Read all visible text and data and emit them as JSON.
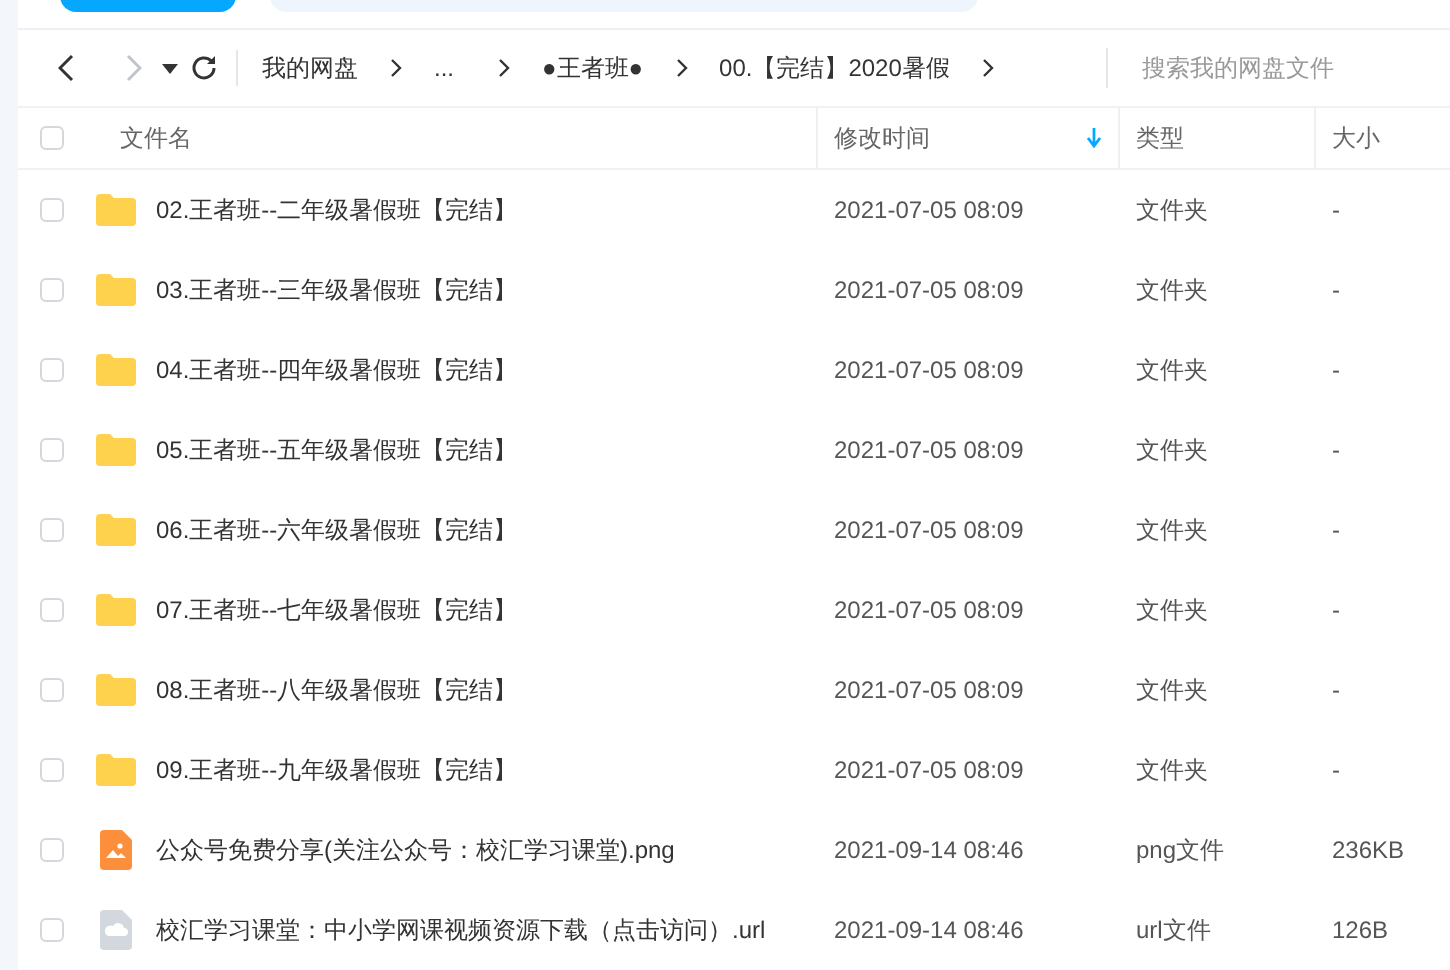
{
  "nav": {
    "back": {
      "disabled": false
    },
    "forward": {
      "disabled": true
    }
  },
  "breadcrumb": [
    {
      "label": "我的网盘"
    },
    {
      "label": "..."
    },
    {
      "label": "●王者班●"
    },
    {
      "label": "00.【完结】2020暑假"
    }
  ],
  "search": {
    "placeholder": "搜索我的网盘文件"
  },
  "table": {
    "select_all": {
      "checked": false
    },
    "columns": [
      {
        "label": "文件名",
        "sorted": false
      },
      {
        "label": "修改时间",
        "sorted": true
      },
      {
        "label": "类型",
        "sorted": false
      },
      {
        "label": "大小",
        "sorted": false
      }
    ],
    "rows": [
      {
        "kind": "folder",
        "checked": false,
        "name": "02.王者班--二年级暑假班【完结】",
        "modified": "2021-07-05 08:09",
        "type": "文件夹",
        "size": "-"
      },
      {
        "kind": "folder",
        "checked": false,
        "name": "03.王者班--三年级暑假班【完结】",
        "modified": "2021-07-05 08:09",
        "type": "文件夹",
        "size": "-"
      },
      {
        "kind": "folder",
        "checked": false,
        "name": "04.王者班--四年级暑假班【完结】",
        "modified": "2021-07-05 08:09",
        "type": "文件夹",
        "size": "-"
      },
      {
        "kind": "folder",
        "checked": false,
        "name": "05.王者班--五年级暑假班【完结】",
        "modified": "2021-07-05 08:09",
        "type": "文件夹",
        "size": "-"
      },
      {
        "kind": "folder",
        "checked": false,
        "name": "06.王者班--六年级暑假班【完结】",
        "modified": "2021-07-05 08:09",
        "type": "文件夹",
        "size": "-"
      },
      {
        "kind": "folder",
        "checked": false,
        "name": "07.王者班--七年级暑假班【完结】",
        "modified": "2021-07-05 08:09",
        "type": "文件夹",
        "size": "-"
      },
      {
        "kind": "folder",
        "checked": false,
        "name": "08.王者班--八年级暑假班【完结】",
        "modified": "2021-07-05 08:09",
        "type": "文件夹",
        "size": "-"
      },
      {
        "kind": "folder",
        "checked": false,
        "name": "09.王者班--九年级暑假班【完结】",
        "modified": "2021-07-05 08:09",
        "type": "文件夹",
        "size": "-"
      },
      {
        "kind": "image",
        "checked": false,
        "name": "公众号免费分享(关注公众号：校汇学习课堂).png",
        "modified": "2021-09-14 08:46",
        "type": "png文件",
        "size": "236KB"
      },
      {
        "kind": "link",
        "checked": false,
        "name": "校汇学习课堂：中小学网课视频资源下载（点击访问）.url",
        "modified": "2021-09-14 08:46",
        "type": "url文件",
        "size": "126B"
      }
    ]
  }
}
